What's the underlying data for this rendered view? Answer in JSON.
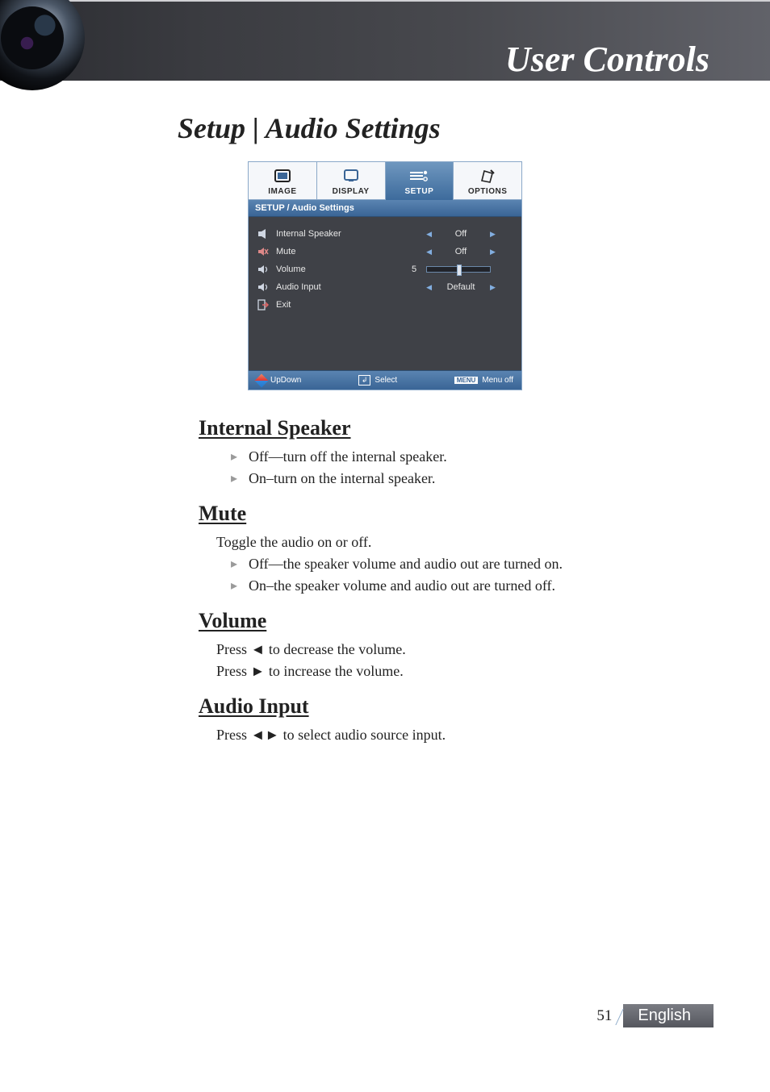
{
  "header": {
    "section_title": "User Controls"
  },
  "page_title": "Setup | Audio Settings",
  "osd": {
    "tabs": [
      {
        "label": "IMAGE",
        "icon": "image-icon"
      },
      {
        "label": "DISPLAY",
        "icon": "display-icon"
      },
      {
        "label": "SETUP",
        "icon": "setup-icon"
      },
      {
        "label": "OPTIONS",
        "icon": "options-icon"
      }
    ],
    "active_tab_index": 2,
    "breadcrumb": "SETUP / Audio Settings",
    "rows": {
      "internal_speaker": {
        "label": "Internal Speaker",
        "value": "Off"
      },
      "mute": {
        "label": "Mute",
        "value": "Off"
      },
      "volume": {
        "label": "Volume",
        "value": "5"
      },
      "audio_input": {
        "label": "Audio Input",
        "value": "Default"
      },
      "exit": {
        "label": "Exit"
      }
    },
    "footer": {
      "updown": "UpDown",
      "select": "Select",
      "menu_badge": "MENU",
      "menuoff": "Menu off"
    }
  },
  "sections": {
    "internal_speaker": {
      "heading": "Internal Speaker",
      "items": [
        "Off—turn off the internal speaker.",
        "On–turn on the internal speaker."
      ]
    },
    "mute": {
      "heading": "Mute",
      "intro": "Toggle the audio on or off.",
      "items": [
        "Off—the speaker volume and audio out are turned on.",
        "On–the speaker volume and audio out are turned off."
      ]
    },
    "volume": {
      "heading": "Volume",
      "lines": [
        "Press ◄ to decrease the volume.",
        "Press ► to increase the volume."
      ]
    },
    "audio_input": {
      "heading": "Audio Input",
      "lines": [
        "Press ◄► to select audio source input."
      ]
    }
  },
  "footer": {
    "page_number": "51",
    "language": "English"
  }
}
